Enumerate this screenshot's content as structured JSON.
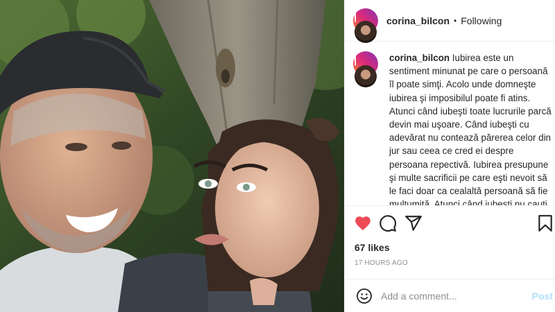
{
  "post": {
    "username": "corina_bilcon",
    "separator": "•",
    "follow_status": "Following",
    "caption_text": "Iubirea este un sentiment minunat pe care o persoană îl poate simţi. Acolo unde domneşte iubirea şi imposibilul poate fi atins. Atunci când iubeşti toate lucrurile parcă devin mai uşoare. Când iubeşti cu adevărat nu contează părerea celor din jur sau ceea ce cred ei despre persoana repectivă. Iubirea presupune şi multe sacrificii pe care eşti nevoit să le faci doar ca cealaltă persoană să fie mulţumită. Atunci când iubeşti nu cauţi folosul tău, ci mereu caută fericirea celui de lângă tine şi asta se vede",
    "likes": "67 likes",
    "timestamp": "17 HOURS AGO",
    "liked": true
  },
  "comment": {
    "placeholder": "Add a comment...",
    "post_label": "Post"
  },
  "icons": {
    "like": "heart-icon",
    "comment": "comment-icon",
    "share": "share-icon",
    "save": "bookmark-icon",
    "emoji": "emoji-icon"
  },
  "colors": {
    "heart": "#ed4956",
    "post_button": "#b2dffc",
    "muted_text": "#8e8e8e"
  }
}
